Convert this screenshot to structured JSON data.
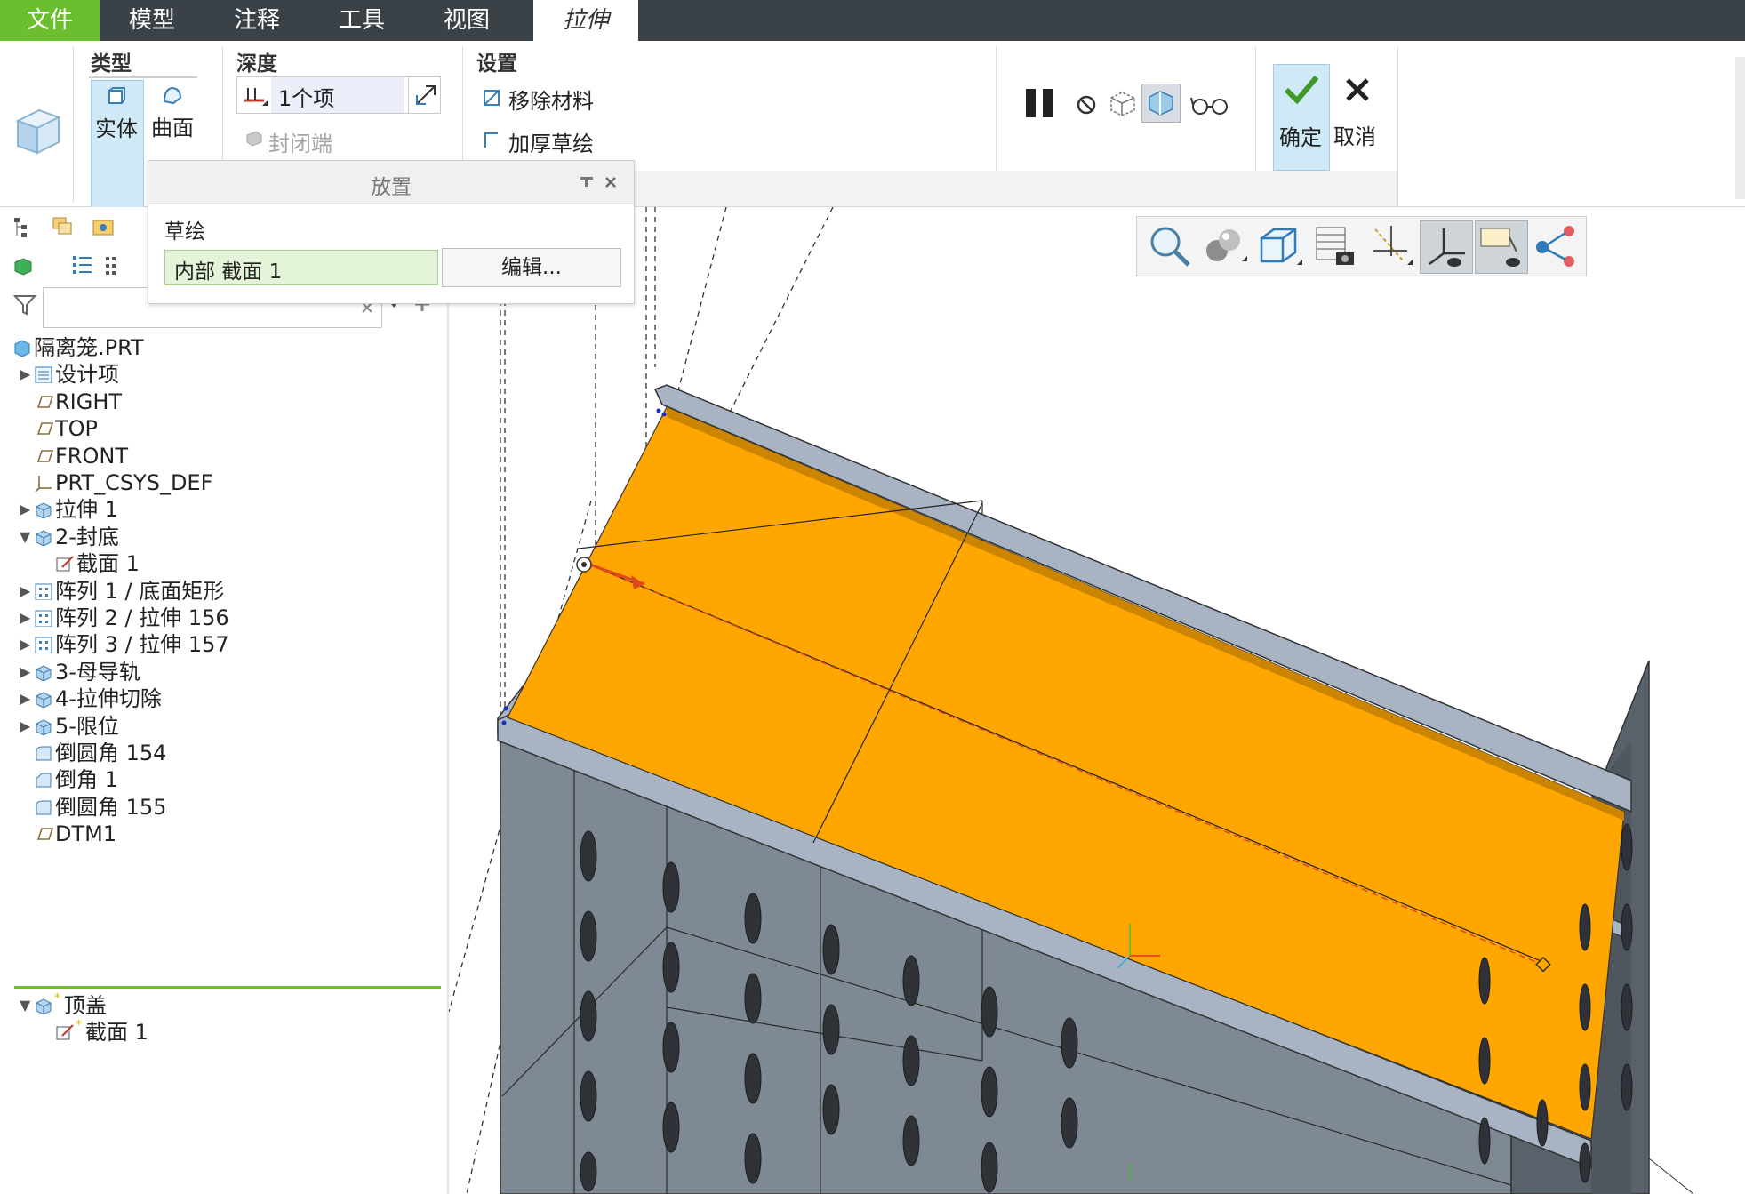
{
  "menu": {
    "tabs": [
      {
        "label": "文件"
      },
      {
        "label": "模型"
      },
      {
        "label": "注释"
      },
      {
        "label": "工具"
      },
      {
        "label": "视图"
      },
      {
        "label": "拉伸"
      }
    ]
  },
  "ribbon": {
    "type_group": {
      "title": "类型",
      "solid": "实体",
      "surface": "曲面"
    },
    "depth_group": {
      "title": "深度",
      "value": "1个项",
      "capped_ends": "封闭端"
    },
    "settings_group": {
      "title": "设置",
      "remove_material": "移除材料",
      "thicken_sketch": "加厚草绘"
    },
    "actions": {
      "ok": "确定",
      "cancel": "取消"
    }
  },
  "placement_panel": {
    "title": "放置",
    "sketch_label": "草绘",
    "sketch_value": "内部 截面 1",
    "edit_button": "编辑..."
  },
  "tree": {
    "filter_placeholder": "",
    "items": [
      {
        "label": "隔离笼.PRT",
        "icon": "part-icon",
        "level": 0,
        "arrow": ""
      },
      {
        "label": "设计项",
        "icon": "design-items-icon",
        "level": 1,
        "arrow": "▶"
      },
      {
        "label": "RIGHT",
        "icon": "datum-plane-icon",
        "level": 1,
        "arrow": ""
      },
      {
        "label": "TOP",
        "icon": "datum-plane-icon",
        "level": 1,
        "arrow": ""
      },
      {
        "label": "FRONT",
        "icon": "datum-plane-icon",
        "level": 1,
        "arrow": ""
      },
      {
        "label": "PRT_CSYS_DEF",
        "icon": "csys-icon",
        "level": 1,
        "arrow": ""
      },
      {
        "label": "拉伸 1",
        "icon": "extrude-icon",
        "level": 1,
        "arrow": "▶"
      },
      {
        "label": "2-封底",
        "icon": "extrude-icon",
        "level": 1,
        "arrow": "▼"
      },
      {
        "label": "截面 1",
        "icon": "sketch-icon",
        "level": 2,
        "arrow": ""
      },
      {
        "label": "阵列 1 / 底面矩形",
        "icon": "pattern-icon",
        "level": 1,
        "arrow": "▶"
      },
      {
        "label": "阵列 2 / 拉伸 156",
        "icon": "pattern-icon",
        "level": 1,
        "arrow": "▶"
      },
      {
        "label": "阵列 3 / 拉伸 157",
        "icon": "pattern-icon",
        "level": 1,
        "arrow": "▶"
      },
      {
        "label": "3-母导轨",
        "icon": "extrude-icon",
        "level": 1,
        "arrow": "▶"
      },
      {
        "label": "4-拉伸切除",
        "icon": "extrude-icon",
        "level": 1,
        "arrow": "▶"
      },
      {
        "label": "5-限位",
        "icon": "extrude-icon",
        "level": 1,
        "arrow": "▶"
      },
      {
        "label": "倒圆角 154",
        "icon": "round-icon",
        "level": 1,
        "arrow": ""
      },
      {
        "label": "倒角 1",
        "icon": "chamfer-icon",
        "level": 1,
        "arrow": ""
      },
      {
        "label": "倒圆角 155",
        "icon": "round-icon",
        "level": 1,
        "arrow": ""
      },
      {
        "label": "DTM1",
        "icon": "datum-plane-icon",
        "level": 1,
        "arrow": ""
      }
    ],
    "new_items": [
      {
        "label": "顶盖",
        "icon": "extrude-icon",
        "level": 1,
        "arrow": "▼"
      },
      {
        "label": "截面 1",
        "icon": "sketch-icon",
        "level": 2,
        "arrow": ""
      }
    ]
  },
  "view_toolbar": {
    "icons": [
      "zoom-icon",
      "appearance-icon",
      "display-style-icon",
      "saved-views-icon",
      "datum-display-icon",
      "csys-display-icon",
      "annotation-display-icon",
      "spin-center-icon"
    ]
  },
  "colors": {
    "menubar": "#3a4147",
    "accent_green": "#6bbf2e",
    "highlight_surface": "#ffa600",
    "model_gray": "#7f8993",
    "selected_bg": "#cfe9f7"
  }
}
